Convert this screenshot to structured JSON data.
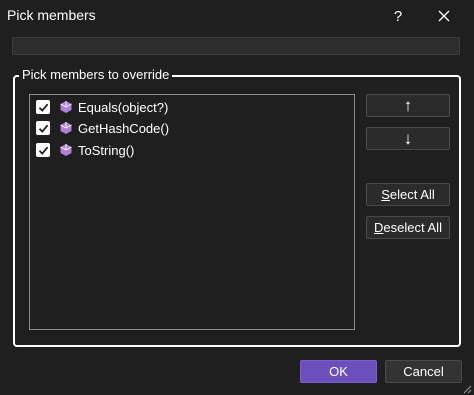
{
  "window": {
    "title": "Pick members",
    "help_label": "?",
    "close_icon": "close-icon"
  },
  "filter": {
    "value": "",
    "placeholder": ""
  },
  "group": {
    "legend": "Pick members to override"
  },
  "members": [
    {
      "label": "Equals(object?)",
      "checked": true,
      "icon": "method-icon"
    },
    {
      "label": "GetHashCode()",
      "checked": true,
      "icon": "method-icon"
    },
    {
      "label": "ToString()",
      "checked": true,
      "icon": "method-icon"
    }
  ],
  "side_buttons": {
    "move_up_label": "↑",
    "move_down_label": "↓",
    "select_all": {
      "accel": "S",
      "rest": "elect All"
    },
    "deselect_all": {
      "accel": "D",
      "rest": "eselect All"
    }
  },
  "footer": {
    "ok_label": "OK",
    "cancel_label": "Cancel"
  },
  "colors": {
    "background": "#1f1f1f",
    "accent": "#6b4fbb",
    "method_icon": "#b180d7"
  }
}
